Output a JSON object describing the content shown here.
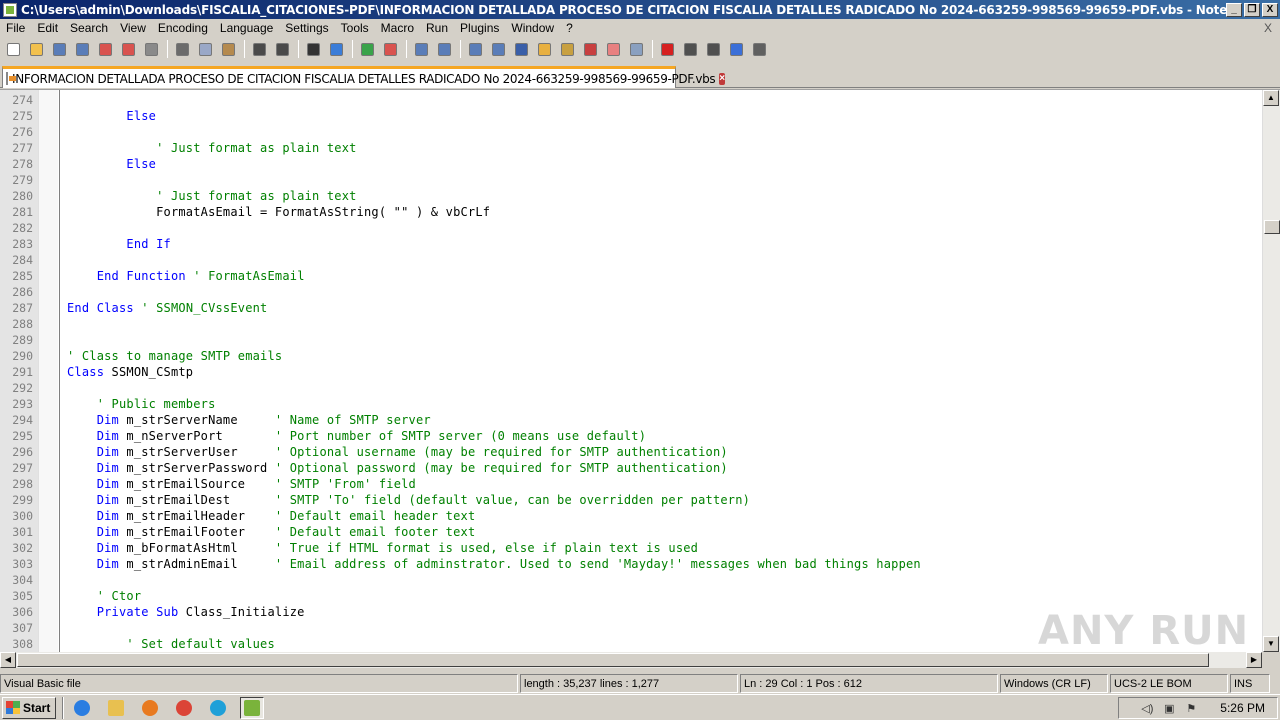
{
  "window": {
    "title": "C:\\Users\\admin\\Downloads\\FISCALIA_CITACIONES-PDF\\INFORMACION DETALLADA PROCESO DE CITACION FISCALIA DETALLES RADICADO No 2024-663259-998569-99659-PDF.vbs - Notepad++",
    "buttons": {
      "minimize": "_",
      "restore": "❐",
      "close": "X"
    }
  },
  "menu": {
    "items": [
      "File",
      "Edit",
      "Search",
      "View",
      "Encoding",
      "Language",
      "Settings",
      "Tools",
      "Macro",
      "Run",
      "Plugins",
      "Window",
      "?"
    ],
    "close": "X"
  },
  "toolbar": {
    "icons": [
      {
        "name": "new-file-icon",
        "color": "#ffffff"
      },
      {
        "name": "open-file-icon",
        "color": "#f2c14e"
      },
      {
        "name": "save-icon",
        "color": "#5a7db8"
      },
      {
        "name": "save-all-icon",
        "color": "#5a7db8"
      },
      {
        "name": "close-file-icon",
        "color": "#d9534f"
      },
      {
        "name": "close-all-icon",
        "color": "#d9534f"
      },
      {
        "name": "print-icon",
        "color": "#8a8a8a"
      },
      {
        "name": "sep"
      },
      {
        "name": "cut-icon",
        "color": "#6b6b6b"
      },
      {
        "name": "copy-icon",
        "color": "#9aa8c7"
      },
      {
        "name": "paste-icon",
        "color": "#b58a4e"
      },
      {
        "name": "sep"
      },
      {
        "name": "undo-icon",
        "color": "#4a4a4a"
      },
      {
        "name": "redo-icon",
        "color": "#4a4a4a"
      },
      {
        "name": "sep"
      },
      {
        "name": "find-icon",
        "color": "#333333"
      },
      {
        "name": "replace-icon",
        "color": "#3b7dd8"
      },
      {
        "name": "sep"
      },
      {
        "name": "zoom-in-icon",
        "color": "#3aa34a"
      },
      {
        "name": "zoom-out-icon",
        "color": "#d9534f"
      },
      {
        "name": "sep"
      },
      {
        "name": "sync-vertical-icon",
        "color": "#5a7db8"
      },
      {
        "name": "sync-horizontal-icon",
        "color": "#5a7db8"
      },
      {
        "name": "sep"
      },
      {
        "name": "word-wrap-icon",
        "color": "#5a7db8"
      },
      {
        "name": "show-all-chars-icon",
        "color": "#5a7db8"
      },
      {
        "name": "indent-guide-icon",
        "color": "#3a5fa8"
      },
      {
        "name": "udl-icon",
        "color": "#e8b040"
      },
      {
        "name": "doc-map-icon",
        "color": "#c8a040"
      },
      {
        "name": "function-list-icon",
        "color": "#c84040"
      },
      {
        "name": "folder-workspace-icon",
        "color": "#e88080"
      },
      {
        "name": "monitoring-icon",
        "color": "#8aa0c0"
      },
      {
        "name": "sep"
      },
      {
        "name": "record-macro-icon",
        "color": "#d62020"
      },
      {
        "name": "stop-macro-icon",
        "color": "#505050"
      },
      {
        "name": "play-macro-icon",
        "color": "#505050"
      },
      {
        "name": "play-multiple-icon",
        "color": "#3b6fd8"
      },
      {
        "name": "save-macro-icon",
        "color": "#606060"
      }
    ]
  },
  "tab": {
    "label": "INFORMACION DETALLADA PROCESO DE CITACION FISCALIA DETALLES RADICADO No 2024-663259-998569-99659-PDF.vbs",
    "close": "×"
  },
  "editor": {
    "lines": [
      {
        "n": "274",
        "parts": []
      },
      {
        "n": "275",
        "parts": [
          {
            "t": "        "
          },
          {
            "k": "Else"
          }
        ]
      },
      {
        "n": "276",
        "parts": []
      },
      {
        "n": "277",
        "parts": [
          {
            "t": "            "
          },
          {
            "c": "' Just format as plain text"
          }
        ]
      },
      {
        "n": "278",
        "parts": [
          {
            "t": "        "
          },
          {
            "k": "Else"
          }
        ]
      },
      {
        "n": "279",
        "parts": []
      },
      {
        "n": "280",
        "parts": [
          {
            "t": "            "
          },
          {
            "c": "' Just format as plain text"
          }
        ]
      },
      {
        "n": "281",
        "parts": [
          {
            "t": "            FormatAsEmail = FormatAsString( \"\" ) & vbCrLf"
          }
        ]
      },
      {
        "n": "282",
        "parts": []
      },
      {
        "n": "283",
        "parts": [
          {
            "t": "        "
          },
          {
            "k": "End If"
          }
        ]
      },
      {
        "n": "284",
        "parts": []
      },
      {
        "n": "285",
        "parts": [
          {
            "t": "    "
          },
          {
            "k": "End Function"
          },
          {
            "t": " "
          },
          {
            "c": "' FormatAsEmail"
          }
        ]
      },
      {
        "n": "286",
        "parts": []
      },
      {
        "n": "287",
        "parts": [
          {
            "k": "End Class"
          },
          {
            "t": " "
          },
          {
            "c": "' SSMON_CVssEvent"
          }
        ]
      },
      {
        "n": "288",
        "parts": []
      },
      {
        "n": "289",
        "parts": []
      },
      {
        "n": "290",
        "parts": [
          {
            "c": "' Class to manage SMTP emails"
          }
        ]
      },
      {
        "n": "291",
        "parts": [
          {
            "k": "Class"
          },
          {
            "t": " SSMON_CSmtp"
          }
        ]
      },
      {
        "n": "292",
        "parts": []
      },
      {
        "n": "293",
        "parts": [
          {
            "t": "    "
          },
          {
            "c": "' Public members"
          }
        ]
      },
      {
        "n": "294",
        "parts": [
          {
            "t": "    "
          },
          {
            "k": "Dim"
          },
          {
            "t": " m_strServerName     "
          },
          {
            "c": "' Name of SMTP server"
          }
        ]
      },
      {
        "n": "295",
        "parts": [
          {
            "t": "    "
          },
          {
            "k": "Dim"
          },
          {
            "t": " m_nServerPort       "
          },
          {
            "c": "' Port number of SMTP server (0 means use default)"
          }
        ]
      },
      {
        "n": "296",
        "parts": [
          {
            "t": "    "
          },
          {
            "k": "Dim"
          },
          {
            "t": " m_strServerUser     "
          },
          {
            "c": "' Optional username (may be required for SMTP authentication)"
          }
        ]
      },
      {
        "n": "297",
        "parts": [
          {
            "t": "    "
          },
          {
            "k": "Dim"
          },
          {
            "t": " m_strServerPassword "
          },
          {
            "c": "' Optional password (may be required for SMTP authentication)"
          }
        ]
      },
      {
        "n": "298",
        "parts": [
          {
            "t": "    "
          },
          {
            "k": "Dim"
          },
          {
            "t": " m_strEmailSource    "
          },
          {
            "c": "' SMTP 'From' field"
          }
        ]
      },
      {
        "n": "299",
        "parts": [
          {
            "t": "    "
          },
          {
            "k": "Dim"
          },
          {
            "t": " m_strEmailDest      "
          },
          {
            "c": "' SMTP 'To' field (default value, can be overridden per pattern)"
          }
        ]
      },
      {
        "n": "300",
        "parts": [
          {
            "t": "    "
          },
          {
            "k": "Dim"
          },
          {
            "t": " m_strEmailHeader    "
          },
          {
            "c": "' Default email header text"
          }
        ]
      },
      {
        "n": "301",
        "parts": [
          {
            "t": "    "
          },
          {
            "k": "Dim"
          },
          {
            "t": " m_strEmailFooter    "
          },
          {
            "c": "' Default email footer text"
          }
        ]
      },
      {
        "n": "302",
        "parts": [
          {
            "t": "    "
          },
          {
            "k": "Dim"
          },
          {
            "t": " m_bFormatAsHtml     "
          },
          {
            "c": "' True if HTML format is used, else if plain text is used"
          }
        ]
      },
      {
        "n": "303",
        "parts": [
          {
            "t": "    "
          },
          {
            "k": "Dim"
          },
          {
            "t": " m_strAdminEmail     "
          },
          {
            "c": "' Email address of adminstrator. Used to send 'Mayday!' messages when bad things happen"
          }
        ]
      },
      {
        "n": "304",
        "parts": []
      },
      {
        "n": "305",
        "parts": [
          {
            "t": "    "
          },
          {
            "c": "' Ctor"
          }
        ]
      },
      {
        "n": "306",
        "parts": [
          {
            "t": "    "
          },
          {
            "k": "Private Sub"
          },
          {
            "t": " Class_Initialize"
          }
        ]
      },
      {
        "n": "307",
        "parts": []
      },
      {
        "n": "308",
        "parts": [
          {
            "t": "        "
          },
          {
            "c": "' Set default values"
          }
        ]
      }
    ]
  },
  "watermark": "ANY RUN",
  "statusbar": {
    "file_type": "Visual Basic file",
    "length": "length : 35,237    lines : 1,277",
    "position": "Ln : 29    Col : 1    Pos : 612",
    "eol": "Windows (CR LF)",
    "encoding": "UCS-2 LE BOM",
    "mode": "INS"
  },
  "taskbar": {
    "start_label": "Start",
    "apps": [
      {
        "name": "ie-icon",
        "color": "#2a7de1"
      },
      {
        "name": "explorer-icon",
        "color": "#e8c050"
      },
      {
        "name": "media-player-icon",
        "color": "#e87a20"
      },
      {
        "name": "chrome-icon",
        "color": "#db4437"
      },
      {
        "name": "edge-icon",
        "color": "#1fa0d8"
      },
      {
        "name": "notepadpp-icon",
        "color": "#7ab33b"
      }
    ],
    "clock": "5:26 PM"
  }
}
